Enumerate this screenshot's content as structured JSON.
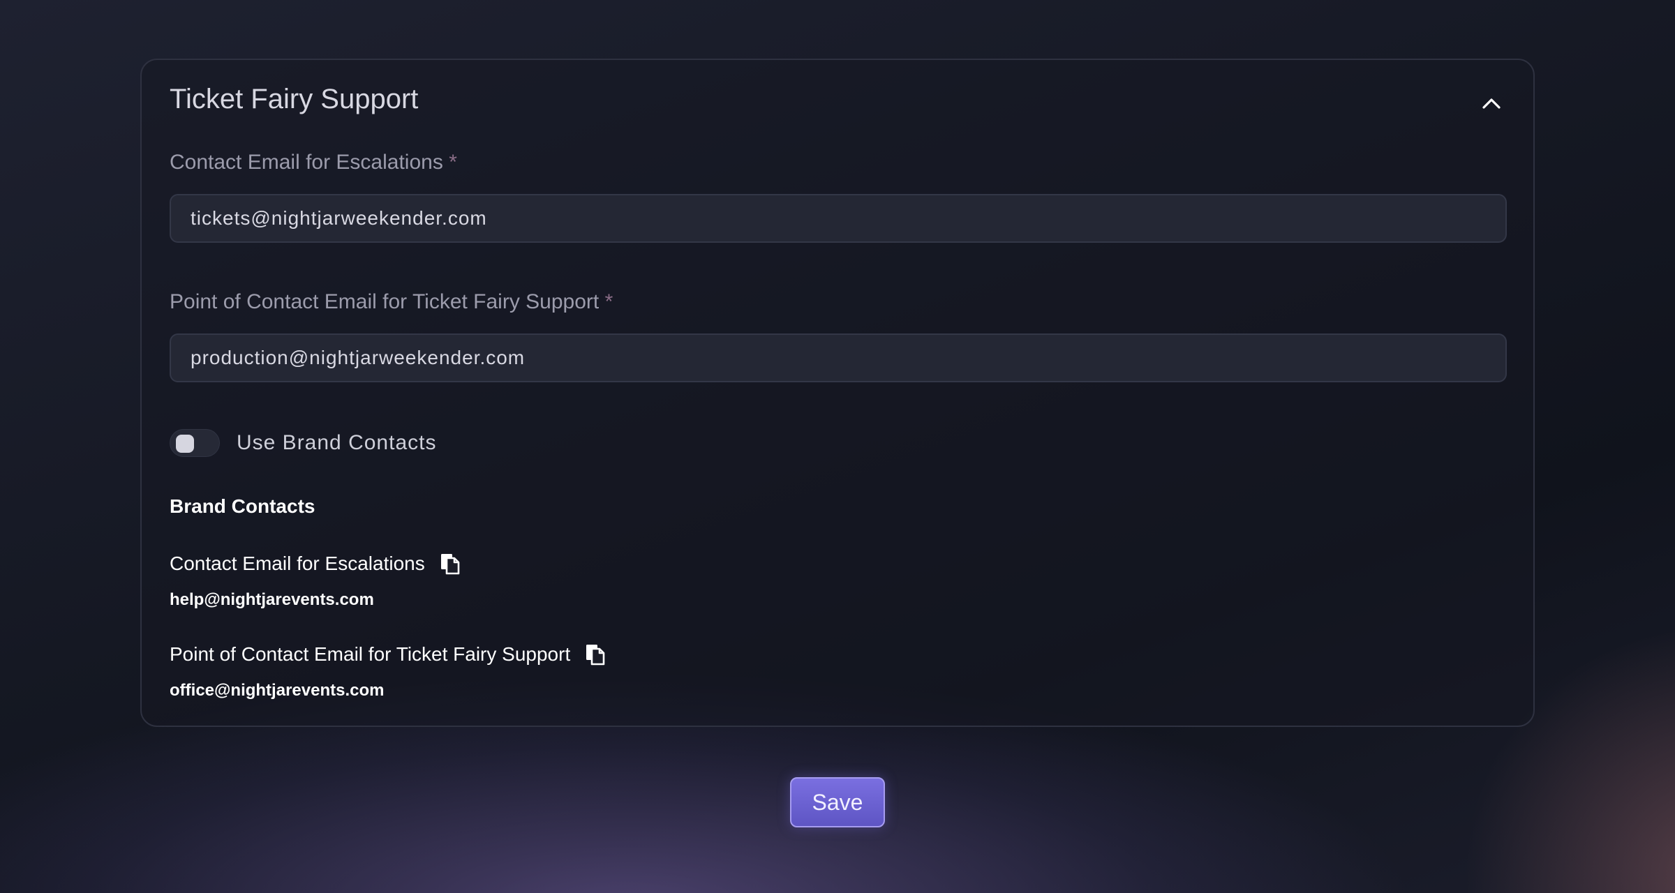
{
  "section": {
    "title": "Ticket Fairy Support"
  },
  "fields": [
    {
      "label": "Contact Email for Escalations",
      "required_mark": "*",
      "value": "tickets@nightjarweekender.com"
    },
    {
      "label": "Point of Contact Email for Ticket Fairy Support",
      "required_mark": "*",
      "value": "production@nightjarweekender.com"
    }
  ],
  "toggle": {
    "label": "Use Brand Contacts",
    "checked": false
  },
  "brand_contacts": {
    "heading": "Brand Contacts",
    "items": [
      {
        "label": "Contact Email for Escalations",
        "value": "help@nightjarevents.com"
      },
      {
        "label": "Point of Contact Email for Ticket Fairy Support",
        "value": "office@nightjarevents.com"
      }
    ]
  },
  "actions": {
    "save_label": "Save"
  },
  "icons": {
    "collapse": "chevron-up-icon",
    "copy": "copy-icon"
  },
  "colors": {
    "accent": "#6c63d8",
    "required": "#8a6d87"
  }
}
